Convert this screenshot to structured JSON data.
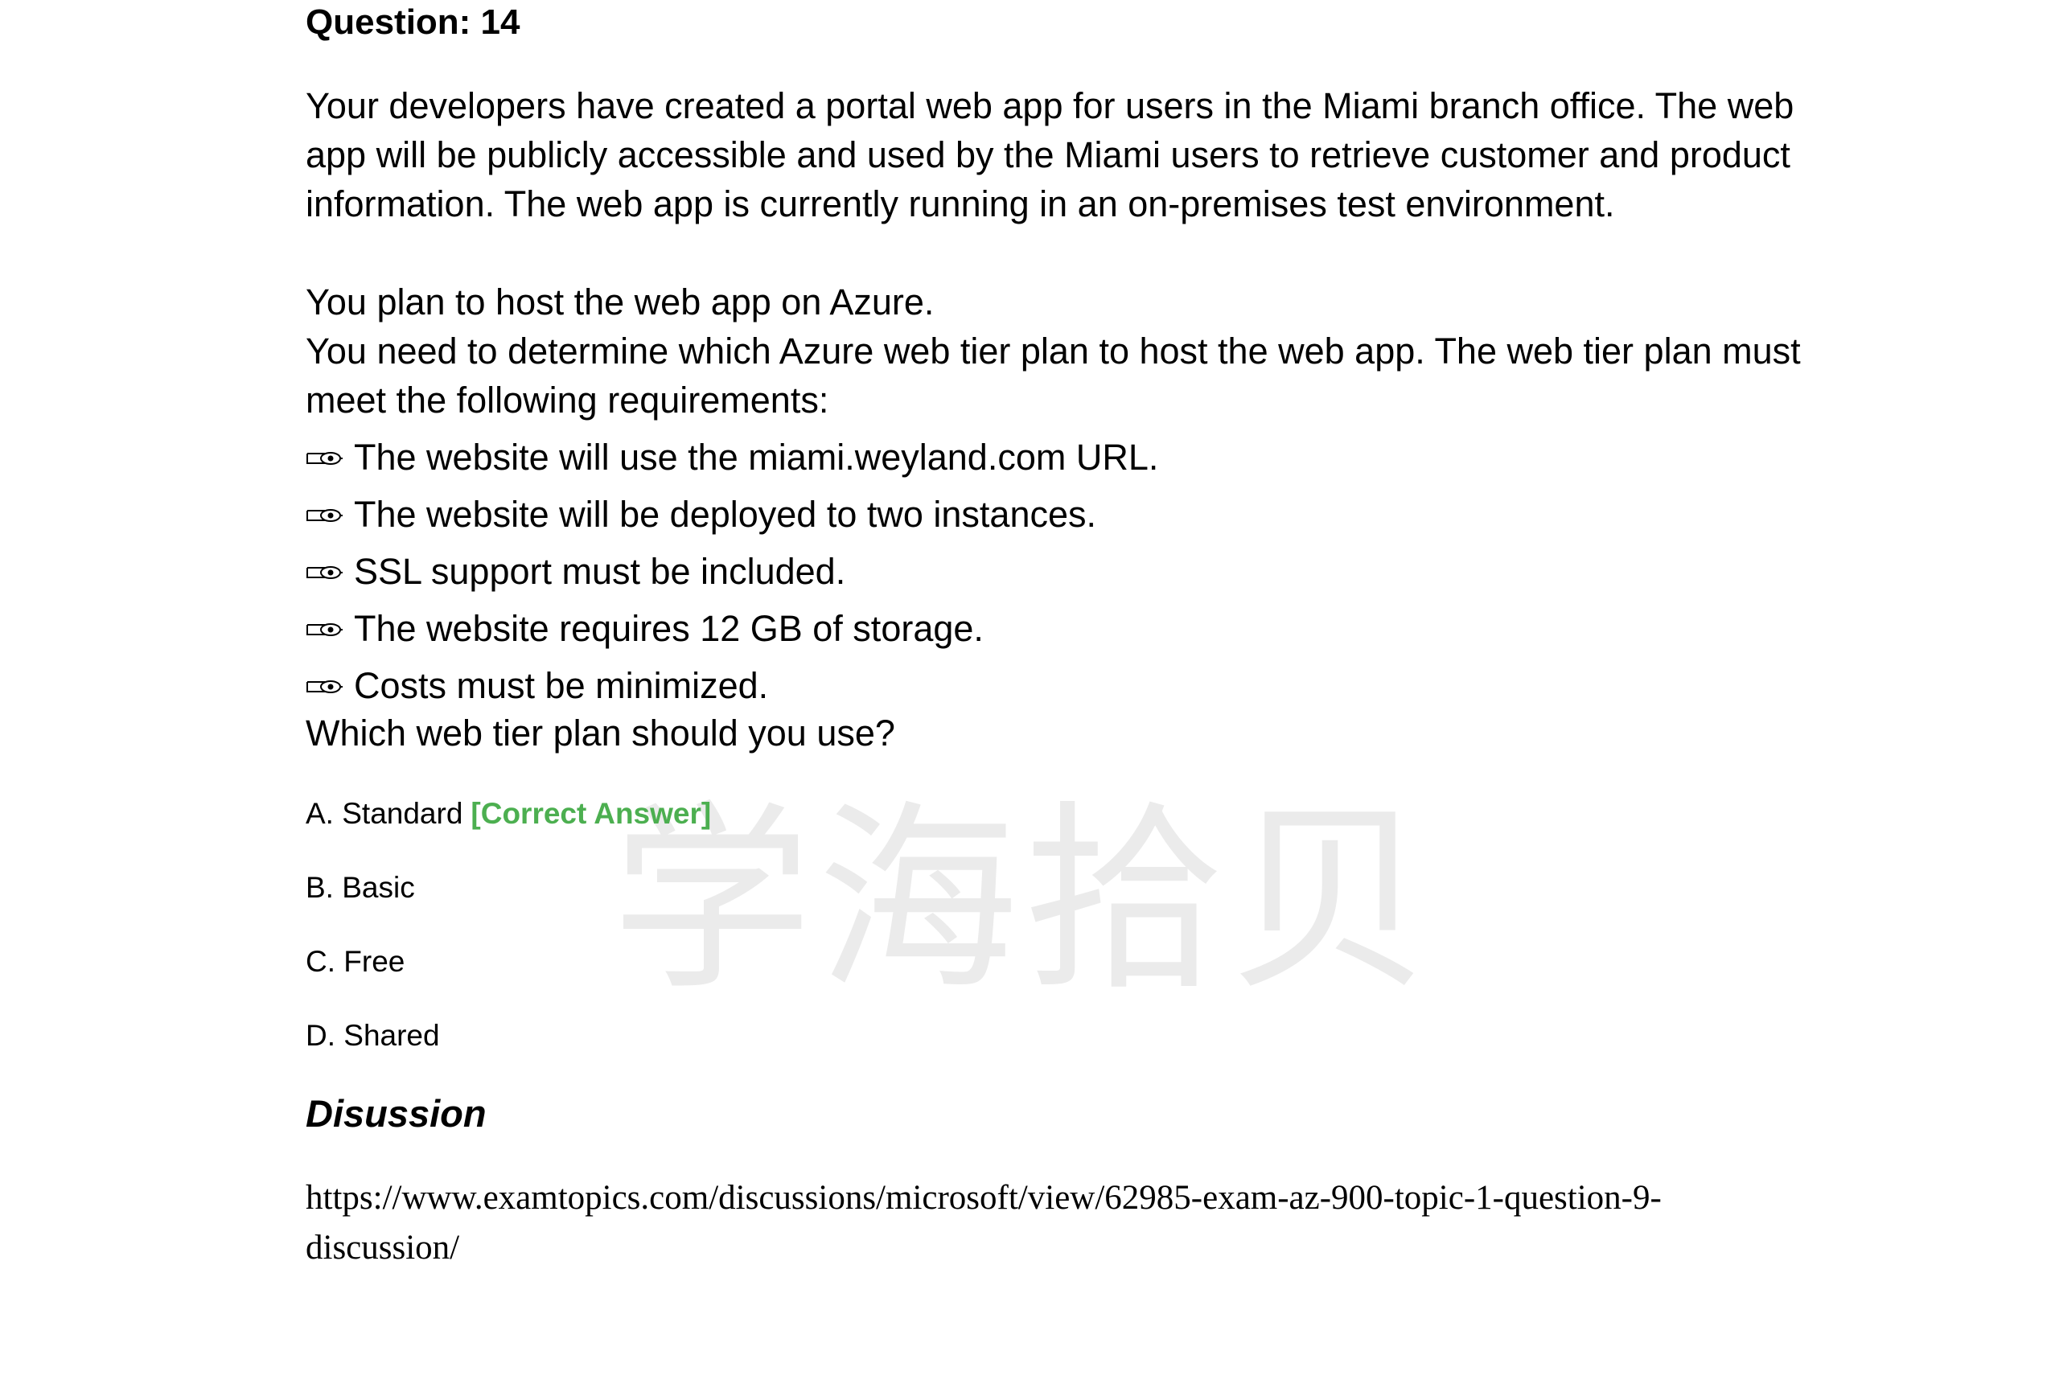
{
  "question": {
    "title": "Question: 14",
    "paragraphs": [
      "Your developers have created a portal web app for users in the Miami branch office. The web app will be publicly accessible and used by the Miami users to retrieve customer and product information. The web app is currently running in an on-premises test environment.",
      "You plan to host the web app on Azure.",
      "You need to determine which Azure web tier plan to host the web app. The web tier plan must meet the following requirements:"
    ],
    "requirements": [
      "The website will use the miami.weyland.com URL.",
      "The website will be deployed to two instances.",
      "SSL support must be included.",
      "The website requires 12 GB of storage.",
      "Costs must be minimized."
    ],
    "prompt": "Which web tier plan should you use?",
    "options": [
      {
        "text": "A. Standard",
        "tag": "[Correct Answer]"
      },
      {
        "text": "B. Basic",
        "tag": ""
      },
      {
        "text": "C. Free",
        "tag": ""
      },
      {
        "text": "D. Shared",
        "tag": ""
      }
    ]
  },
  "discussion": {
    "heading": "Disussion",
    "link": "https://www.examtopics.com/discussions/microsoft/view/62985-exam-az-900-topic-1-question-9-discussion/"
  },
  "watermark": {
    "text": "学海拾贝"
  },
  "colors": {
    "text": "#000000",
    "correct": "#4caf50",
    "watermark": "#ebebeb",
    "background": "#ffffff"
  },
  "icons": {
    "bullet": "pointing-hand-icon"
  }
}
